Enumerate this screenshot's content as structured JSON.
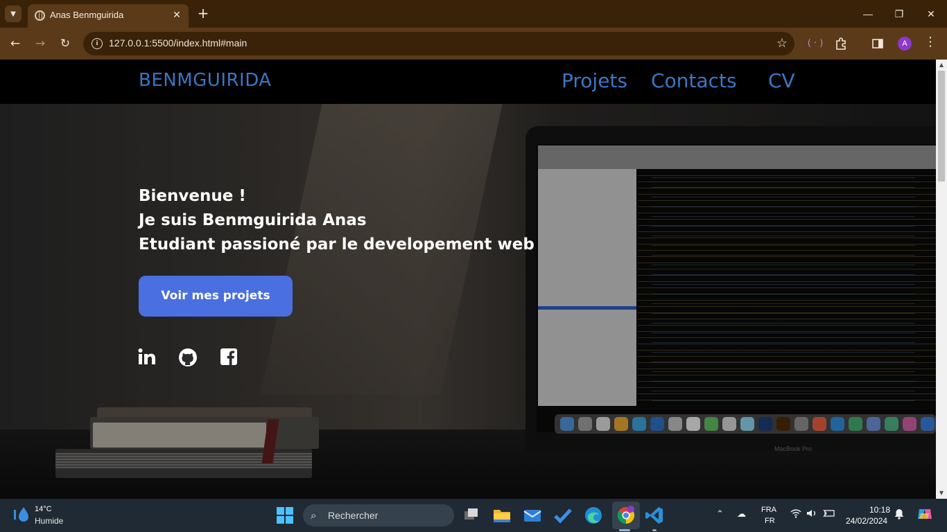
{
  "browser": {
    "tab_title": "Anas Benmguirida",
    "tab_close_glyph": "✕",
    "new_tab_glyph": "+",
    "url": "127.0.0.1:5500/index.html#main",
    "minimize_glyph": "—",
    "maximize_glyph": "❐",
    "close_glyph": "✕",
    "back_glyph": "←",
    "forward_glyph": "→",
    "reload_glyph": "↻",
    "info_glyph": "i",
    "star_glyph": "☆",
    "profile_initial": "A",
    "accent_color": "#5a3a18"
  },
  "site": {
    "brand": "BENMGUIRIDA",
    "nav": [
      "Projets",
      "Contacts",
      "CV"
    ],
    "hero_lines": [
      "Bienvenue !",
      "Je suis Benmguirida Anas",
      "Etudiant passioné par le developement web"
    ],
    "cta_label": "Voir mes projets",
    "social": [
      {
        "icon": "linkedin-icon"
      },
      {
        "icon": "github-icon"
      },
      {
        "icon": "facebook-icon"
      }
    ],
    "laptop_label": "MacBook Pro",
    "brand_color": "#3a77c4",
    "button_color": "#4a6fe0"
  },
  "taskbar": {
    "weather_temp": "14°C",
    "weather_desc": "Humide",
    "search_placeholder": "Rechercher",
    "lang_top": "FRA",
    "lang_bottom": "FR",
    "time": "10:18",
    "date": "24/02/2024"
  }
}
